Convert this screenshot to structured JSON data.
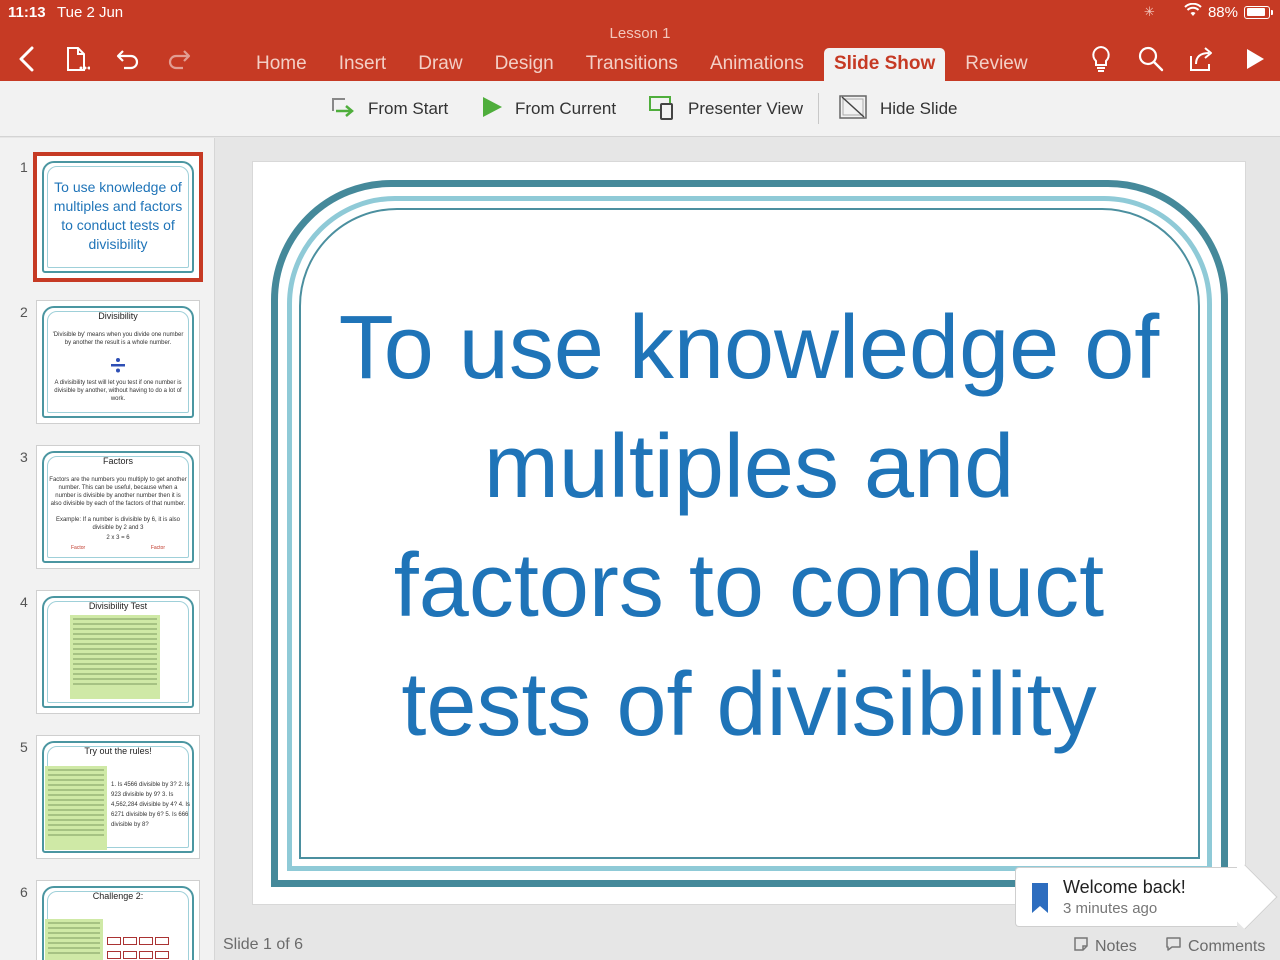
{
  "status_bar": {
    "time": "11:13",
    "date": "Tue 2 Jun",
    "battery": "88%",
    "battery_level": 0.88
  },
  "document": {
    "title": "Lesson 1"
  },
  "toolbar_icons": [
    "back-icon",
    "document-icon",
    "undo-icon",
    "redo-icon",
    "lightbulb-icon",
    "search-icon",
    "share-icon",
    "play-icon"
  ],
  "tabs": [
    {
      "label": "Home"
    },
    {
      "label": "Insert"
    },
    {
      "label": "Draw"
    },
    {
      "label": "Design"
    },
    {
      "label": "Transitions"
    },
    {
      "label": "Animations"
    },
    {
      "label": "Slide Show",
      "active": true
    },
    {
      "label": "Review"
    }
  ],
  "ribbon": {
    "from_start": "From Start",
    "from_current": "From Current",
    "presenter_view": "Presenter View",
    "hide_slide": "Hide Slide"
  },
  "thumbnails": [
    {
      "number": "1",
      "text": "To use knowledge of multiples and factors to conduct tests of divisibility"
    },
    {
      "number": "2",
      "title": "Divisibility",
      "body1": "'Divisible by' means when you divide one number by another the result is a whole number.",
      "body2": "A divisibility test will let you test if one number is divisible by another, without having to do a lot of work."
    },
    {
      "number": "3",
      "title": "Factors",
      "body1": "Factors are the numbers you multiply to get another number. This can be useful, because when a number is divisible by another number then it is also divisible by each of the factors of that number.",
      "body2": "Example: If a number is divisible by 6, it is also divisible by 2 and 3",
      "eq": "2 x 3 = 6",
      "label_left": "Factor",
      "label_right": "Factor"
    },
    {
      "number": "4",
      "title": "Divisibility Test"
    },
    {
      "number": "5",
      "title": "Try out the rules!",
      "questions": "1. Is 4566 divisible by 3? 2. Is 923 divisible by 9? 3. Is 4,562,284 divisible by 4? 4. Is 6271 divisible by 6? 5. Is 666 divisible by 8?"
    },
    {
      "number": "6",
      "title": "Challenge 2:"
    }
  ],
  "slide": {
    "lines": [
      "To use knowledge of",
      "multiples and",
      "factors to conduct",
      "tests of divisibility"
    ]
  },
  "footer": {
    "slide_count": "Slide 1 of 6",
    "notes": "Notes",
    "comments": "Comments"
  },
  "toast": {
    "title": "Welcome back!",
    "subtitle": "3 minutes ago"
  },
  "colors": {
    "accent": "#c63a24",
    "title_blue": "#1f74b8",
    "frame_teal": "#45899a",
    "frame_light": "#8fcad7"
  }
}
